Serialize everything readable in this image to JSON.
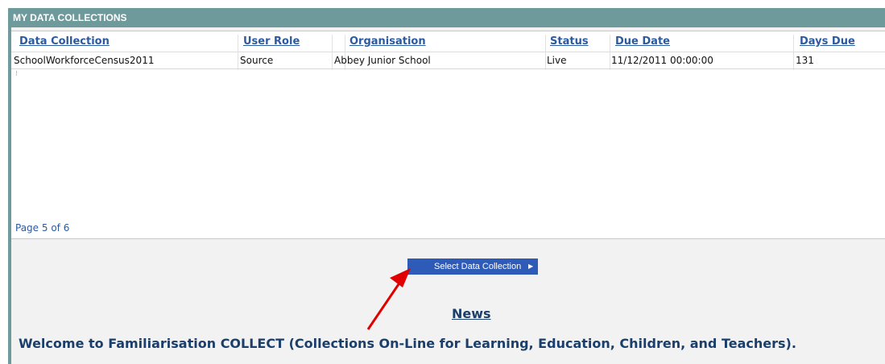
{
  "panel": {
    "title": "MY DATA COLLECTIONS"
  },
  "table": {
    "headers": [
      "Data Collection",
      "User Role",
      "Organisation",
      "Status",
      "Due Date",
      "Days Due"
    ],
    "rows": [
      [
        "SchoolWorkforceCensus2011",
        "Source",
        "Abbey Junior School",
        "Live",
        "11/12/2011 00:00:00",
        "131"
      ]
    ]
  },
  "pager": {
    "text": "Page 5 of 6"
  },
  "actions": {
    "select_label": "Select Data Collection"
  },
  "news": {
    "heading": "News",
    "welcome": "Welcome to Familiarisation COLLECT (Collections On-Line for Learning, Education, Children, and Teachers)."
  },
  "colors": {
    "header_bg": "#6e9a9c",
    "link": "#2c5aa0",
    "button_bg": "#2f5bb8",
    "news_text": "#1b3f6a",
    "annotation_arrow": "#e00000"
  },
  "icons": {
    "button_arrow": "chevron-right-icon",
    "annotation": "red-arrow-icon"
  }
}
